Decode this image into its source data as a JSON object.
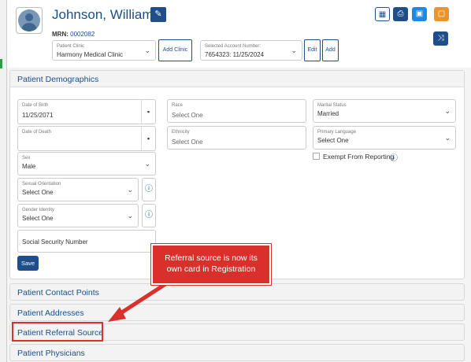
{
  "patient": {
    "name": "Johnson, William",
    "mrn_label": "MRN:",
    "mrn_value": "0002082"
  },
  "clinic": {
    "label": "Patient Clinic",
    "value": "Harmony Medical Clinic",
    "add_button": "Add Clinic"
  },
  "account": {
    "label": "Selected Account Number:",
    "value": "7654323: 11/25/2024",
    "edit_button": "Edit",
    "add_button": "Add"
  },
  "demographics": {
    "title": "Patient Demographics",
    "dob": {
      "label": "Date of Birth",
      "value": "11/25/2071"
    },
    "dod": {
      "label": "Date of Death",
      "value": ""
    },
    "sex": {
      "label": "Sex",
      "value": "Male"
    },
    "orientation": {
      "label": "Sexual Orientation",
      "value": "Select One"
    },
    "gender": {
      "label": "Gender Identity",
      "value": "Select One"
    },
    "ssn": {
      "label": "Social Security Number"
    },
    "race": {
      "label": "Race",
      "value": "Select One"
    },
    "ethnicity": {
      "label": "Ethnicity",
      "value": "Select One"
    },
    "marital": {
      "label": "Marital Status",
      "value": "Married"
    },
    "language": {
      "label": "Primary Language",
      "value": "Select One"
    },
    "exempt": {
      "label": "Exempt From Reporting"
    },
    "save_button": "Save"
  },
  "sections": [
    "Patient Contact Points",
    "Patient Addresses",
    "Patient Referral Source",
    "Patient Physicians"
  ],
  "callout": {
    "line1": "Referral source is now its",
    "line2": "own card in Registration"
  },
  "colors": {
    "primary": "#1f4e8a",
    "accent_orange": "#e8952e",
    "annotation_red": "#d9302c"
  },
  "icons": {
    "edit": "edit-icon",
    "grid": "grid-icon",
    "print": "print-icon",
    "calendar": "calendar-icon",
    "calendar_alt": "calendar-alt-icon",
    "shuffle": "shuffle-icon"
  }
}
